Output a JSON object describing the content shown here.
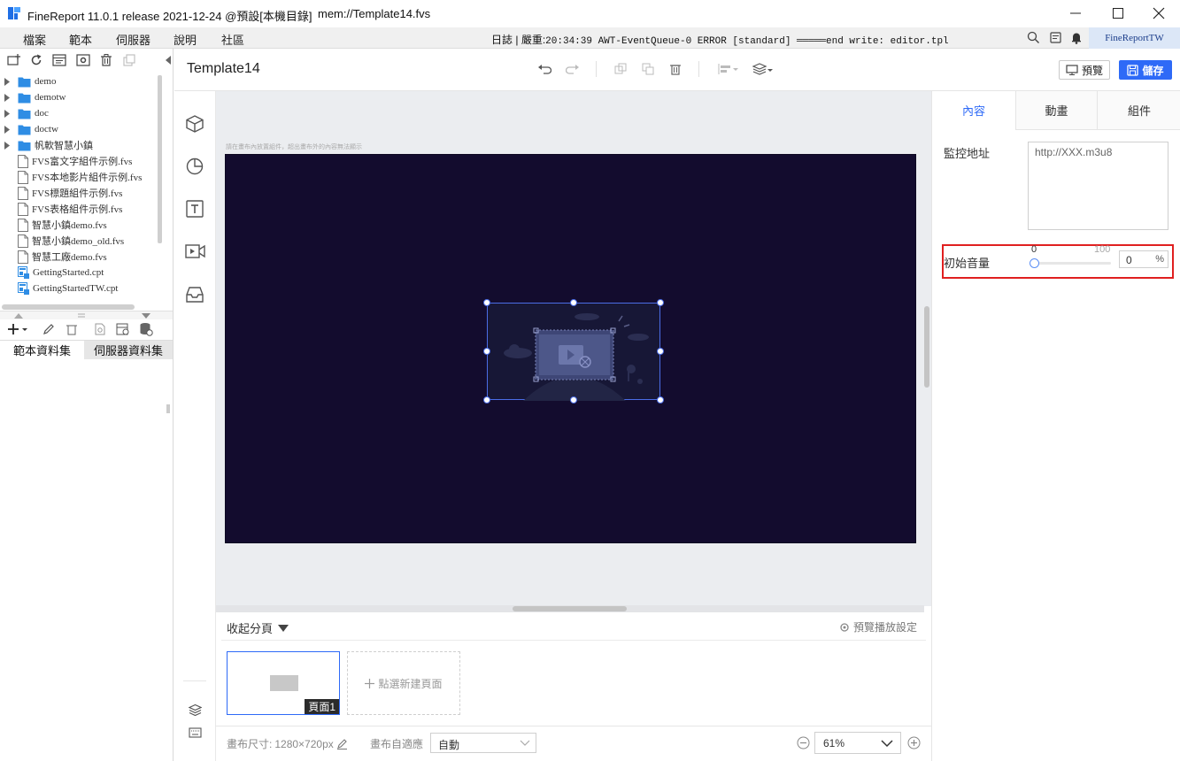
{
  "window": {
    "title": "FineReport 11.0.1 release 2021-12-24 @預設[本機目錄]",
    "file": "mem://Template14.fvs"
  },
  "menu": {
    "items": [
      "檔案",
      "範本",
      "伺服器",
      "說明",
      "社區"
    ],
    "log_label": "日誌",
    "log_sep": "|",
    "log_level": "嚴重:",
    "log_text": "20:34:39 AWT-EventQueue-0 ERROR [standard] ═════end write: editor.tpl",
    "user": "FineReportTW"
  },
  "tree": {
    "items": [
      {
        "label": "demo",
        "type": "folder"
      },
      {
        "label": "demotw",
        "type": "folder"
      },
      {
        "label": "doc",
        "type": "folder"
      },
      {
        "label": "doctw",
        "type": "folder"
      },
      {
        "label": "帆軟智慧小鎮",
        "type": "folder"
      },
      {
        "label": "FVS富文字組件示例.fvs",
        "type": "file"
      },
      {
        "label": "FVS本地影片組件示例.fvs",
        "type": "file"
      },
      {
        "label": "FVS標題組件示例.fvs",
        "type": "file"
      },
      {
        "label": "FVS表格組件示例.fvs",
        "type": "file"
      },
      {
        "label": "智慧小鎮demo.fvs",
        "type": "file"
      },
      {
        "label": "智慧小鎮demo_old.fvs",
        "type": "file"
      },
      {
        "label": "智慧工廠demo.fvs",
        "type": "file"
      },
      {
        "label": "GettingStarted.cpt",
        "type": "cpt"
      },
      {
        "label": "GettingStartedTW.cpt",
        "type": "cpt"
      }
    ]
  },
  "dataset_tabs": {
    "template": "範本資料集",
    "server": "伺服器資料集"
  },
  "header": {
    "template_name": "Template14",
    "preview": "預覽",
    "save": "儲存"
  },
  "canvas": {
    "hint": "請在畫布內放置組件，超出畫布外的內容無法顯示"
  },
  "pages": {
    "collapse": "收起分頁",
    "play_settings": "預覽播放設定",
    "page1": "頁面1",
    "new_page": "點選新建頁面"
  },
  "footer": {
    "canvas_size_label": "畫布尺寸:",
    "canvas_size": "1280×720px",
    "adapt_label": "畫布自適應",
    "adapt_value": "自動",
    "zoom": "61%"
  },
  "right": {
    "tabs": [
      "內容",
      "動畫",
      "組件"
    ],
    "monitor_label": "監控地址",
    "monitor_value": "http://XXX.m3u8",
    "volume_label": "初始音量",
    "volume_min": "0",
    "volume_max": "100",
    "volume_value": "0",
    "volume_unit": "%",
    "volume_level": 0
  },
  "colors": {
    "accent": "#2e6af7",
    "canvas_bg": "#130c2e",
    "highlight_border": "#e02020"
  }
}
